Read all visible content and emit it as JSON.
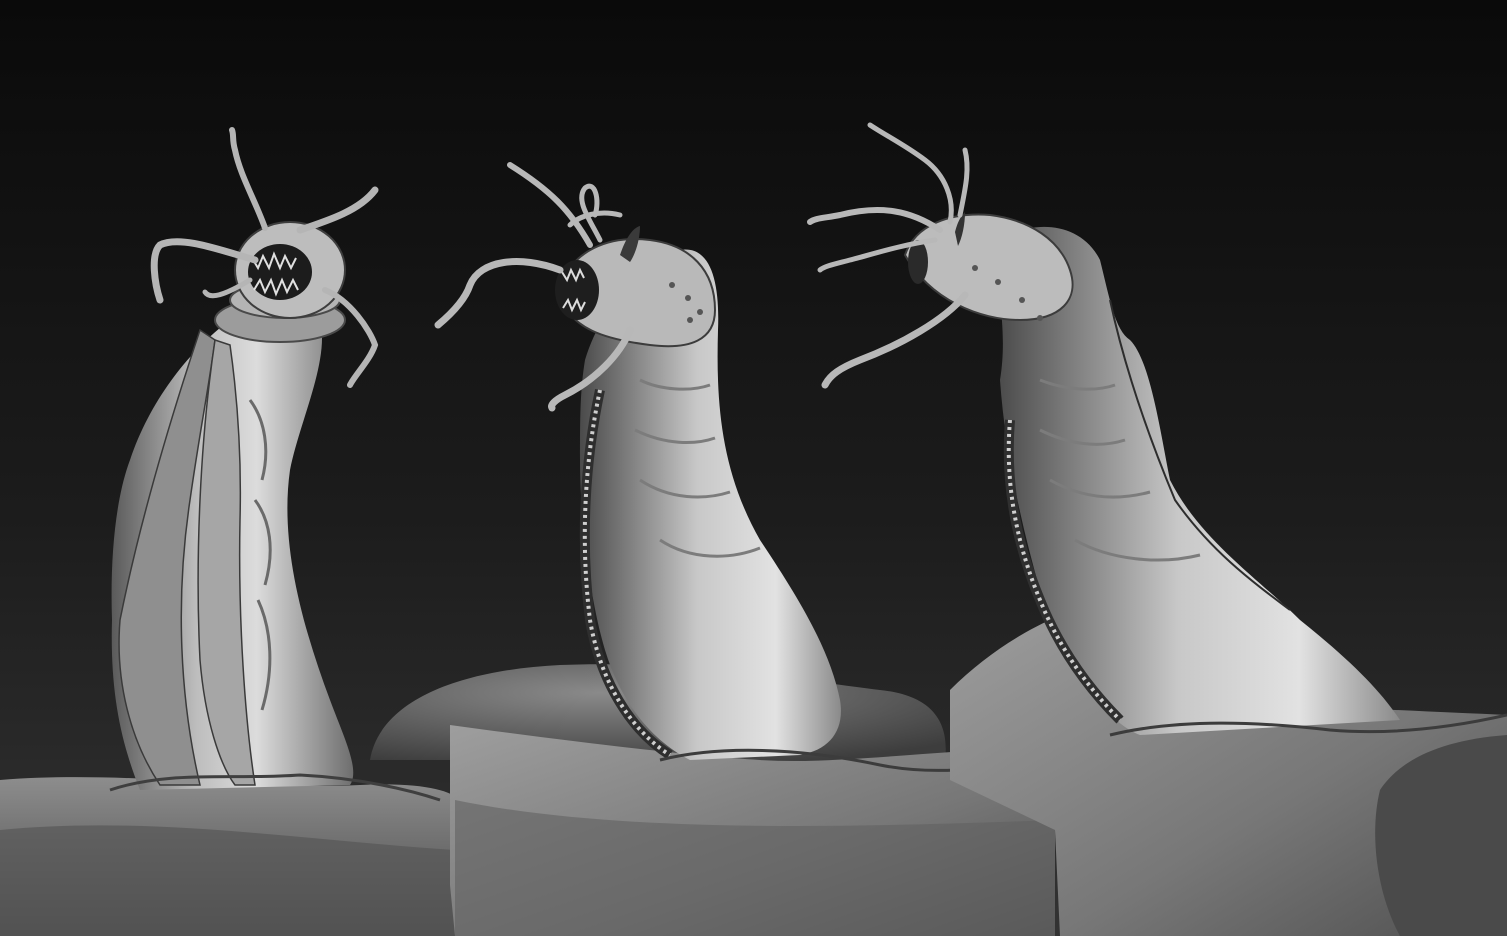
{
  "scene": {
    "background_top": "#0b0b0b",
    "background_bottom": "#2e2e2e",
    "clay_light": "#d9d9d9",
    "clay_mid": "#9a9a9a",
    "clay_dark": "#3c3c3c",
    "views": [
      {
        "name": "creature-view-front",
        "angle": "front"
      },
      {
        "name": "creature-view-three-quarter",
        "angle": "three-quarter"
      },
      {
        "name": "creature-view-side",
        "angle": "side"
      }
    ]
  }
}
